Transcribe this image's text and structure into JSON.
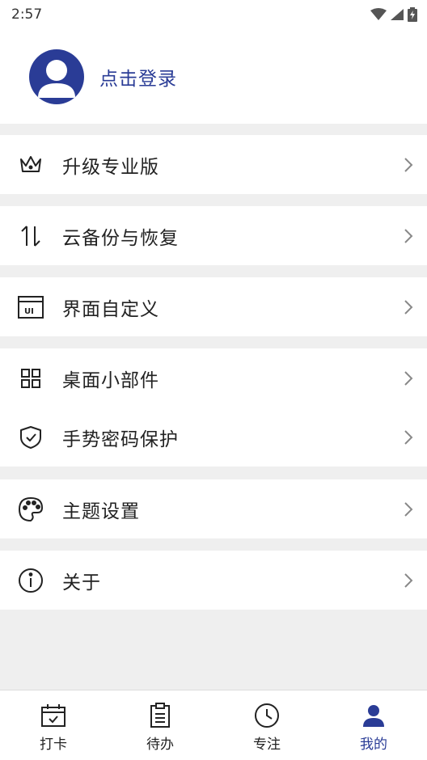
{
  "status": {
    "time": "2:57"
  },
  "profile": {
    "login_text": "点击登录"
  },
  "menu_groups": [
    {
      "items": [
        {
          "label": "升级专业版",
          "icon": "crown-icon"
        }
      ]
    },
    {
      "items": [
        {
          "label": "云备份与恢复",
          "icon": "sync-arrows-icon"
        }
      ]
    },
    {
      "items": [
        {
          "label": "界面自定义",
          "icon": "ui-window-icon"
        }
      ]
    },
    {
      "items": [
        {
          "label": "桌面小部件",
          "icon": "widgets-icon"
        },
        {
          "label": "手势密码保护",
          "icon": "shield-check-icon"
        }
      ]
    },
    {
      "items": [
        {
          "label": "主题设置",
          "icon": "palette-icon"
        }
      ]
    },
    {
      "items": [
        {
          "label": "关于",
          "icon": "info-icon"
        }
      ]
    }
  ],
  "tabs": [
    {
      "label": "打卡",
      "icon": "calendar-check-icon"
    },
    {
      "label": "待办",
      "icon": "clipboard-icon"
    },
    {
      "label": "专注",
      "icon": "clock-icon"
    },
    {
      "label": "我的",
      "icon": "person-icon",
      "active": true
    }
  ],
  "colors": {
    "accent": "#2a3c96",
    "background": "#efefef"
  }
}
